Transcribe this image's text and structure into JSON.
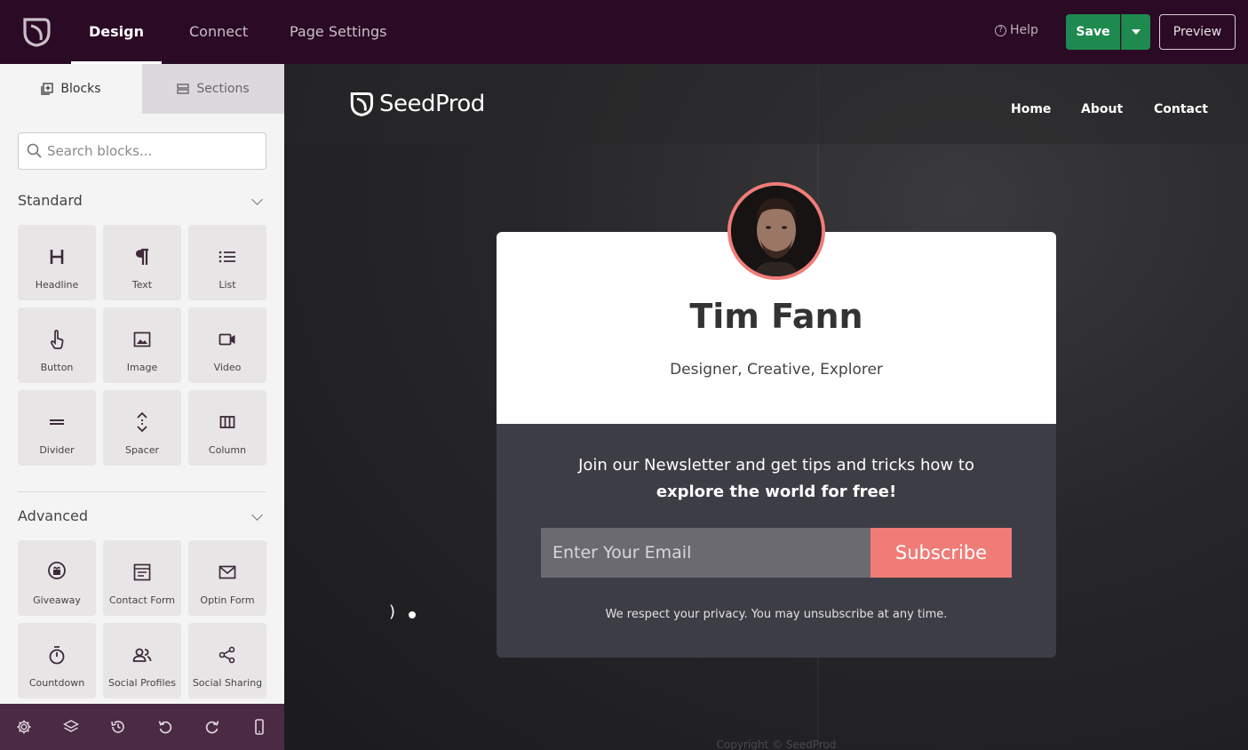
{
  "topbar": {
    "tabs": [
      "Design",
      "Connect",
      "Page Settings"
    ],
    "help": "Help",
    "save": "Save",
    "preview": "Preview"
  },
  "sidebar": {
    "tabs": {
      "blocks": "Blocks",
      "sections": "Sections"
    },
    "search_placeholder": "Search blocks...",
    "standard": {
      "title": "Standard",
      "items": [
        "Headline",
        "Text",
        "List",
        "Button",
        "Image",
        "Video",
        "Divider",
        "Spacer",
        "Column"
      ]
    },
    "advanced": {
      "title": "Advanced",
      "items": [
        "Giveaway",
        "Contact Form",
        "Optin Form",
        "Countdown",
        "Social Profiles",
        "Social Sharing"
      ]
    }
  },
  "site": {
    "logo_text": "SeedProd",
    "nav": [
      "Home",
      "About",
      "Contact"
    ],
    "name": "Tim Fann",
    "tagline": "Designer, Creative, Explorer",
    "newsletter_line1": "Join our Newsletter and get tips and tricks how to",
    "newsletter_line2": "explore the world for free!",
    "email_placeholder": "Enter Your Email",
    "subscribe": "Subscribe",
    "privacy": "We respect your privacy. You may unsubscribe at any time.",
    "copyright": "Copyright © SeedProd"
  },
  "colors": {
    "topbar": "#2a0a24",
    "save": "#1e8a4f",
    "accent": "#f07c78",
    "card_dark": "#3d3d45"
  }
}
